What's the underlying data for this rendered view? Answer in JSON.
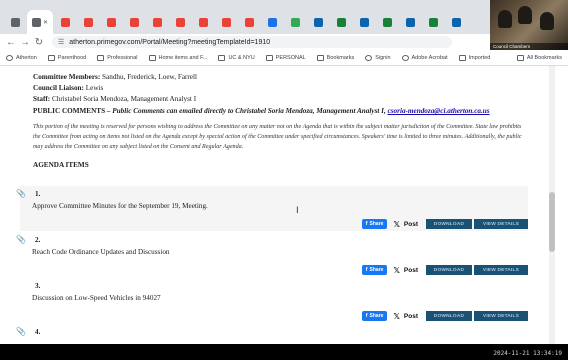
{
  "browser": {
    "tabs": [
      {
        "icon": "document-icon",
        "color": "#5f6368",
        "active": false
      },
      {
        "icon": "music-note-icon",
        "color": "#5f6368",
        "active": true
      },
      {
        "icon": "gmail-icon",
        "color": "#ea4335",
        "active": false
      },
      {
        "icon": "gmail-icon",
        "color": "#ea4335",
        "active": false
      },
      {
        "icon": "gmail-icon",
        "color": "#ea4335",
        "active": false
      },
      {
        "icon": "gmail-icon",
        "color": "#ea4335",
        "active": false
      },
      {
        "icon": "gmail-icon",
        "color": "#ea4335",
        "active": false
      },
      {
        "icon": "gmail-icon",
        "color": "#ea4335",
        "active": false
      },
      {
        "icon": "gmail-icon",
        "color": "#ea4335",
        "active": false
      },
      {
        "icon": "gmail-icon",
        "color": "#ea4335",
        "active": false
      },
      {
        "icon": "gmail-icon",
        "color": "#ea4335",
        "active": false
      },
      {
        "icon": "link-icon",
        "color": "#1a73e8",
        "active": false
      },
      {
        "icon": "google-icon",
        "color": "#34a853",
        "active": false
      },
      {
        "icon": "outlook-icon",
        "color": "#0a64ad",
        "active": false
      },
      {
        "icon": "sheets-icon",
        "color": "#188038",
        "active": false
      },
      {
        "icon": "outlook-icon",
        "color": "#0a64ad",
        "active": false
      },
      {
        "icon": "sheets-icon",
        "color": "#188038",
        "active": false
      },
      {
        "icon": "outlook-icon",
        "color": "#0a64ad",
        "active": false
      },
      {
        "icon": "sheets-icon",
        "color": "#188038",
        "active": false
      },
      {
        "icon": "outlook-icon",
        "color": "#0a64ad",
        "active": false
      }
    ],
    "url": "atherton.primegov.com/Portal/Meeting?meetingTemplateId=1910",
    "bookmarks": [
      {
        "label": "Atherton",
        "icon": "globe-icon"
      },
      {
        "label": "Parenthood",
        "icon": "folder-icon"
      },
      {
        "label": "Professional",
        "icon": "folder-icon"
      },
      {
        "label": "Home items and F...",
        "icon": "folder-icon"
      },
      {
        "label": "UC & NYU",
        "icon": "folder-icon"
      },
      {
        "label": "PERSONAL",
        "icon": "folder-icon"
      },
      {
        "label": "Bookmarks",
        "icon": "bookmark-icon"
      },
      {
        "label": "Signin",
        "icon": "signin-icon"
      },
      {
        "label": "Adobe Acrobat",
        "icon": "acrobat-icon"
      },
      {
        "label": "Imported",
        "icon": "folder-icon"
      }
    ],
    "all_bookmarks_label": "All Bookmarks"
  },
  "webcam": {
    "caption": "Council Chambers"
  },
  "meeting": {
    "committee_members_label": "Committee Members:",
    "committee_members": "Sandhu, Frederick, Loew, Farrell",
    "council_liaison_label": "Council Liaison:",
    "council_liaison": "Lewis",
    "staff_label": "Staff:",
    "staff": "Christabel Soria Mendoza, Management Analyst I",
    "public_comments_label": "PUBLIC COMMENTS",
    "public_comments_text": " – Public Comments can emailed directly to Christabel Soria Mendoza, Management Analyst I, ",
    "public_comments_email": "csoria-mendoza@ci.atherton.ca.us",
    "intro": "This portion of the meeting is reserved for persons wishing to address the Committee on any matter not on the Agenda that is within the subject matter jurisdiction of the Committee. State law prohibits the Committee from acting on items not listed on the Agenda except by special action of the Committee under specified circumstances. Speakers' time is limited to three minutes. Additionally, the public may address the Committee on any subject listed on the Consent and Regular Agenda.",
    "agenda_heading": "AGENDA ITEMS"
  },
  "agenda_items": [
    {
      "number": "1.",
      "title": "Approve Committee Minutes for the September 19, Meeting."
    },
    {
      "number": "2.",
      "title": "Reach Code Ordinance Updates and Discussion"
    },
    {
      "number": "3.",
      "title": "Discussion on Low-Speed Vehicles in 94027"
    },
    {
      "number": "4.",
      "title": ""
    }
  ],
  "actions": {
    "share_label": "Share",
    "post_label": "Post",
    "download_label": "DOWNLOAD",
    "view_details_label": "VIEW DETAILS"
  },
  "timestamp": "2024-11-21 13:34:19"
}
